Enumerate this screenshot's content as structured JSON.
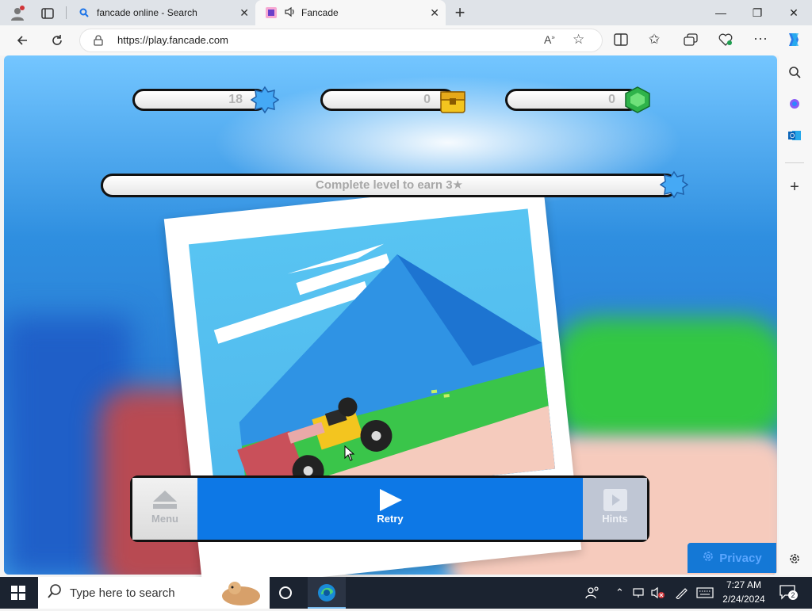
{
  "browser": {
    "tabs": [
      {
        "title": "fancade online - Search",
        "icon": "search-icon",
        "active": false
      },
      {
        "title": "Fancade",
        "icon": "fancade-favicon",
        "active": true,
        "audio": true
      }
    ],
    "new_tab_symbol": "+",
    "url": "https://play.fancade.com",
    "window_controls": {
      "minimize": "—",
      "restore": "❐",
      "close": "✕"
    }
  },
  "game": {
    "counters": [
      {
        "value": "18",
        "icon": "star-badge-icon"
      },
      {
        "value": "0",
        "icon": "chest-icon"
      },
      {
        "value": "0",
        "icon": "gem-icon"
      }
    ],
    "level_progress_text": "Complete level to earn 3★",
    "menu": {
      "menu_label": "Menu",
      "retry_label": "Retry",
      "hints_label": "Hints"
    },
    "privacy_label": "Privacy",
    "colors": {
      "retry": "#0d78e6",
      "grass": "#33c743",
      "sky": "#58c4f2"
    }
  },
  "taskbar": {
    "search_placeholder": "Type here to search",
    "time": "7:27 AM",
    "date": "2/24/2024",
    "notification_count": "2"
  }
}
